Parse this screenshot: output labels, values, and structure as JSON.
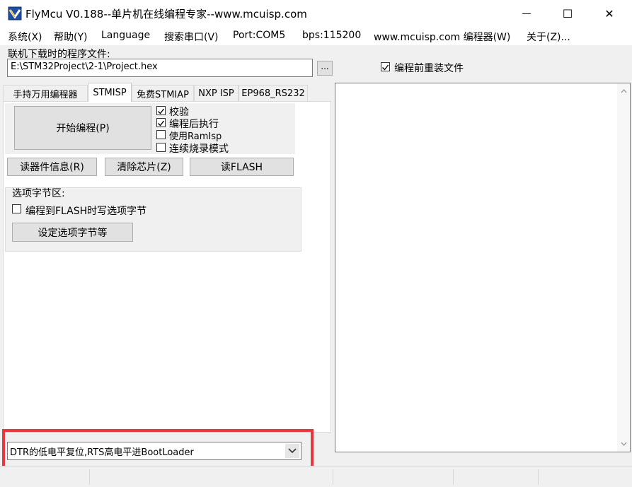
{
  "window": {
    "title": "FlyMcu V0.188--单片机在线编程专家--www.mcuisp.com",
    "minimize_glyph": "—",
    "maximize_glyph": "☐",
    "close_glyph": "✕"
  },
  "menu": {
    "items": [
      "系统(X)",
      "帮助(Y)",
      "Language",
      "搜索串口(V)",
      "Port:COM5",
      "bps:115200",
      "www.mcuisp.com 编程器(W)",
      "关于(Z)..."
    ]
  },
  "file": {
    "label": "联机下载时的程序文件:",
    "path": "E:\\STM32Project\\2-1\\Project.hex",
    "browse_label": "...",
    "reload_label": "编程前重装文件",
    "reload_checked": true
  },
  "tabs": {
    "items": [
      "手持万用编程器",
      "STMISP",
      "免费STMIAP",
      "NXP ISP",
      "EP968_RS232"
    ],
    "active_index": 1
  },
  "stmisp": {
    "start_button": "开始编程(P)",
    "options": [
      {
        "label": "校验",
        "checked": true
      },
      {
        "label": "编程后执行",
        "checked": true
      },
      {
        "label": "使用RamIsp",
        "checked": false
      },
      {
        "label": "连续烧录模式",
        "checked": false
      }
    ],
    "read_info_button": "读器件信息(R)",
    "erase_button": "清除芯片(Z)",
    "read_flash_button": "读FLASH",
    "option_bytes_group": "选项字节区:",
    "write_option_bytes_label": "编程到FLASH时写选项字节",
    "write_option_bytes_checked": false,
    "set_option_bytes_button": "设定选项字节等"
  },
  "bootmode": {
    "selected": "DTR的低电平复位,RTS高电平进BootLoader"
  },
  "colors": {
    "highlight_box": "#e8383d",
    "accent": "#0078d7"
  }
}
